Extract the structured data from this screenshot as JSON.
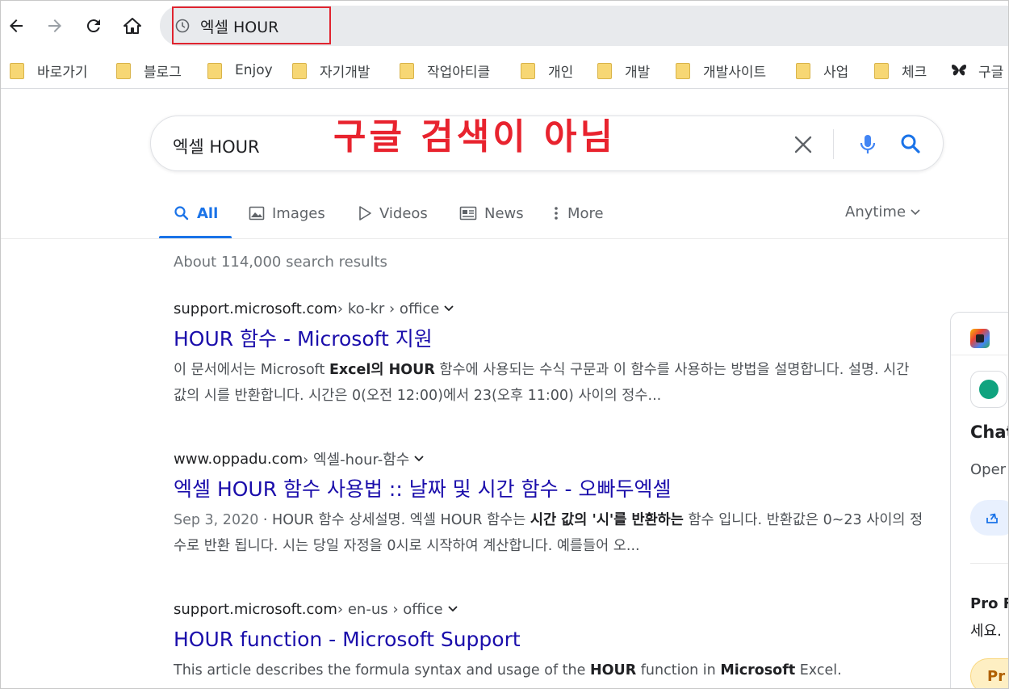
{
  "browser": {
    "omnibox_text": "엑셀 HOUR",
    "bookmarks": [
      {
        "label": "바로가기",
        "icon": "folder-icon"
      },
      {
        "label": "블로그",
        "icon": "folder-icon"
      },
      {
        "label": "Enjoy",
        "icon": "folder-icon"
      },
      {
        "label": "자기개발",
        "icon": "folder-icon"
      },
      {
        "label": "작업아티클",
        "icon": "folder-icon"
      },
      {
        "label": "개인",
        "icon": "folder-icon"
      },
      {
        "label": "개발",
        "icon": "folder-icon"
      },
      {
        "label": "개발사이트",
        "icon": "folder-icon"
      },
      {
        "label": "사업",
        "icon": "folder-icon"
      },
      {
        "label": "체크",
        "icon": "folder-icon"
      },
      {
        "label": "구글",
        "icon": "butterfly-icon"
      }
    ]
  },
  "annotation": "구글 검색이 아님",
  "search": {
    "query": "엑셀 HOUR",
    "tabs": [
      "All",
      "Images",
      "Videos",
      "News",
      "More"
    ],
    "active_tab": "All",
    "time_filter": "Anytime",
    "stats": "About 114,000 search results"
  },
  "results": [
    {
      "domain": "support.microsoft.com",
      "path": " › ko-kr › office",
      "title": "HOUR 함수 - Microsoft 지원",
      "snippet": [
        "이 문서에서는 Microsoft ",
        "Excel의 HOUR",
        " 함수에 사용되는 수식 구문과 이 함수를 사용하는 방법을 설명합니다. 설명. 시간 값의 시를 반환합니다. 시간은 0(오전 12:00)에서 23(오후 11:00) 사이의 정수..."
      ]
    },
    {
      "domain": "www.oppadu.com",
      "path": " › 엑셀-hour-함수",
      "title": "엑셀 HOUR 함수 사용법 :: 날짜 및 시간 함수 - 오빠두엑셀",
      "date": "Sep 3, 2020",
      "snippet": [
        " · HOUR 함수 상세설명. 엑셀 HOUR 함수는 ",
        "시간 값의 '시'를 반환하는",
        " 함수 입니다. 반환값은 0~23 사이의 정수로 반환 됩니다. 시는 당일 자정을 0시로 시작하여 계산합니다. 예를들어 오..."
      ]
    },
    {
      "domain": "support.microsoft.com",
      "path": " › en-us › office",
      "title": "HOUR function - Microsoft Support",
      "snippet": [
        "This article describes the formula syntax and usage of the ",
        "HOUR",
        " function in ",
        "Microsoft",
        " Excel."
      ]
    }
  ],
  "side_panel": {
    "name": "Chat",
    "sub": "Oper",
    "pro_title": "Pro F",
    "pro_sub": "세요.",
    "pro_button": "Pr"
  },
  "colors": {
    "accent": "#1a73e8",
    "link": "#1a0dab",
    "annotation": "#e8232e"
  }
}
